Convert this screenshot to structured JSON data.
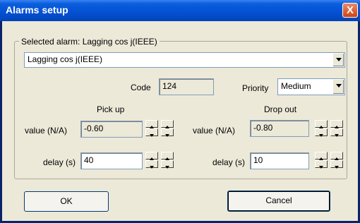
{
  "window": {
    "title": "Alarms setup",
    "close_glyph": "X"
  },
  "selected_alarm": {
    "group_label": "Selected alarm: Lagging cos j(IEEE)",
    "value": "Lagging cos j(IEEE)"
  },
  "code": {
    "label": "Code",
    "value": "124"
  },
  "priority": {
    "label": "Priority",
    "value": "Medium"
  },
  "pickup": {
    "heading": "Pick up",
    "value_label": "value (N/A)",
    "value": "-0.60",
    "delay_label": "delay (s)",
    "delay": "40"
  },
  "dropout": {
    "heading": "Drop out",
    "value_label": "value (N/A)",
    "value": "-0.80",
    "delay_label": "delay (s)",
    "delay": "10"
  },
  "buttons": {
    "ok": "OK",
    "cancel": "Cancel"
  },
  "icons": [
    "close-icon",
    "dropdown-arrow-icon",
    "spin-up-icon",
    "spin-down-icon"
  ]
}
